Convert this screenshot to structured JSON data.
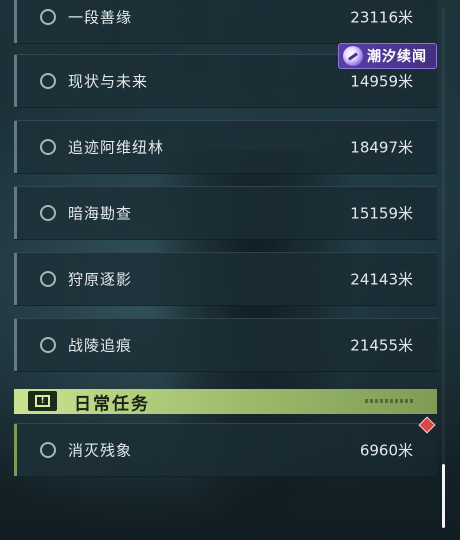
{
  "tasks": [
    {
      "name": "一段善缘",
      "distance": "23116米"
    },
    {
      "name": "现状与未来",
      "distance": "14959米"
    },
    {
      "name": "追迹阿维纽林",
      "distance": "18497米"
    },
    {
      "name": "暗海勘查",
      "distance": "15159米"
    },
    {
      "name": "狩原逐影",
      "distance": "24143米"
    },
    {
      "name": "战陵追痕",
      "distance": "21455米"
    }
  ],
  "daily_section": {
    "title": "日常任务",
    "icon": "warning-icon",
    "tasks": [
      {
        "name": "消灭残象",
        "distance": "6960米"
      }
    ]
  },
  "badge": {
    "text": "潮汐续闻",
    "icon": "tide-logo-icon"
  },
  "colors": {
    "daily_header": "#b5d27f",
    "badge": "#4d35a0",
    "alert_diamond": "#d8474a",
    "text": "#e3e8ea"
  }
}
